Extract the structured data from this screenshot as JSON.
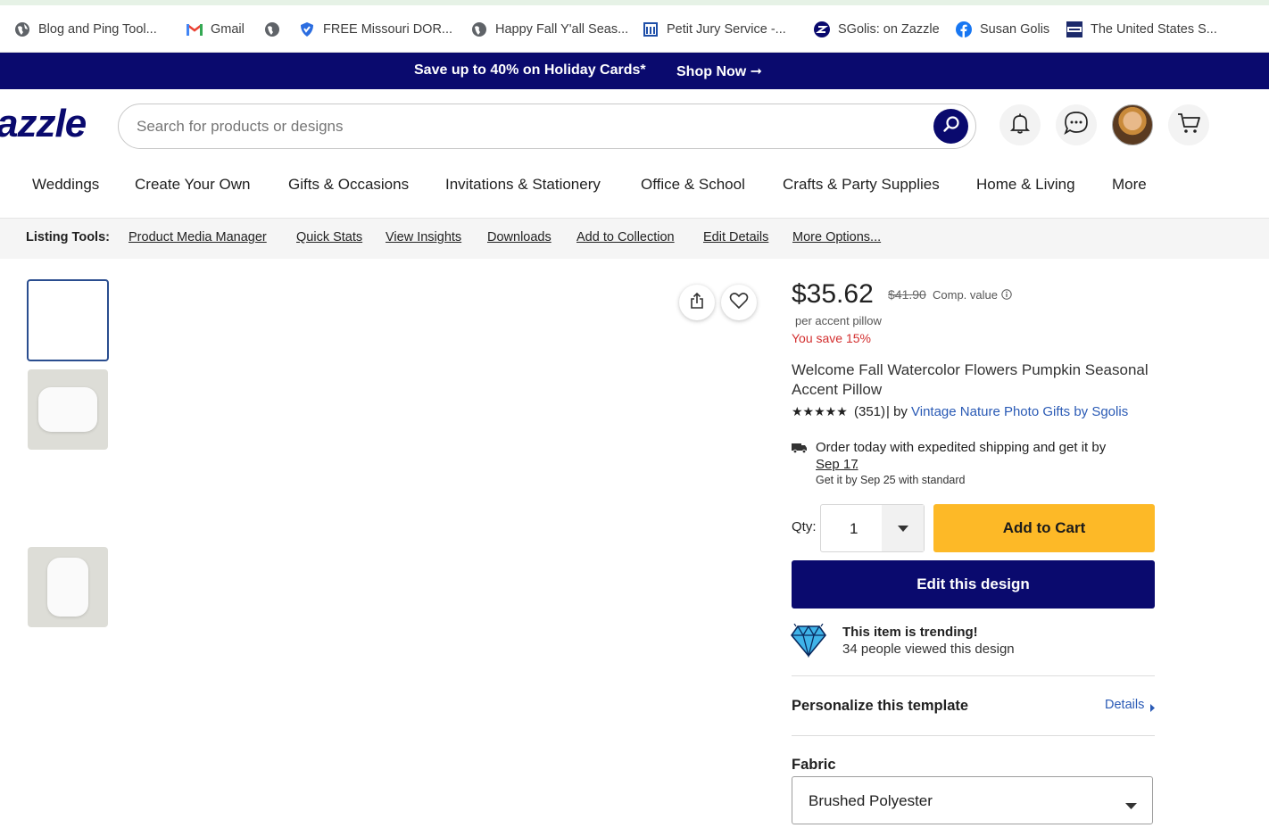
{
  "bookmarks": [
    {
      "label": "Blog and Ping Tool...",
      "icon": "globe-icon"
    },
    {
      "label": "Gmail",
      "icon": "gmail-icon"
    },
    {
      "label": "",
      "icon": "globe-icon"
    },
    {
      "label": "FREE Missouri DOR...",
      "icon": "shield-icon"
    },
    {
      "label": "Happy Fall Y'all Seas...",
      "icon": "globe-icon"
    },
    {
      "label": "Petit Jury Service -...",
      "icon": "courthouse-icon"
    },
    {
      "label": "SGolis: on Zazzle",
      "icon": "zazzle-icon"
    },
    {
      "label": "Susan Golis",
      "icon": "facebook-icon"
    },
    {
      "label": "The United States S...",
      "icon": "ssa-icon"
    }
  ],
  "promo": {
    "text": "Save up to 40% on Holiday Cards*",
    "cta": "Shop Now ➞"
  },
  "header": {
    "logo": "azzle",
    "search_placeholder": "Search for products or designs"
  },
  "nav": [
    "Weddings",
    "Create Your Own",
    "Gifts & Occasions",
    "Invitations & Stationery",
    "Office & School",
    "Crafts & Party Supplies",
    "Home & Living",
    "More"
  ],
  "listing_tools": {
    "label": "Listing Tools:",
    "links": [
      "Product Media Manager",
      "Quick Stats",
      "View Insights",
      "Downloads",
      "Add to Collection",
      "Edit Details",
      "More Options..."
    ]
  },
  "product": {
    "price": "$35.62",
    "comp_price": "$41.90",
    "comp_label": "Comp. value",
    "unit": "per accent pillow",
    "savings": "You save 15%",
    "title_line1": "Welcome Fall Watercolor Flowers Pumpkin Seasonal",
    "title_line2": "Accent Pillow",
    "stars": "★★★★★",
    "reviews": "(351)",
    "by": "| by",
    "store": "Vintage Nature Photo Gifts by Sgolis",
    "shipping_line1": "Order today with expedited shipping and get it by",
    "shipping_date": "Sep 17",
    "shipping_period": ".",
    "standard": "Get it by Sep 25 with standard",
    "qty_label": "Qty:",
    "qty_value": "1",
    "add_to_cart": "Add to Cart",
    "edit_design": "Edit this design",
    "trending_title": "This item is trending!",
    "trending_sub": "34 people viewed this design",
    "personalize": "Personalize this template",
    "details": "Details",
    "fabric_label": "Fabric",
    "fabric_value": "Brushed Polyester"
  },
  "colors": {
    "brand_navy": "#0a0a6e",
    "cart_yellow": "#fdb927",
    "sale_red": "#d32f2f",
    "link_blue": "#2a5ab5"
  }
}
